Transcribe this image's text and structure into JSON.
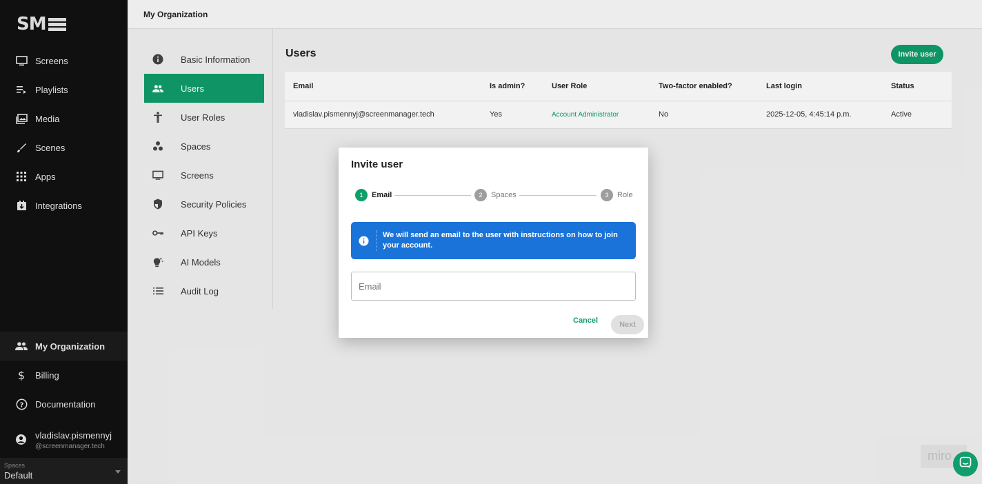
{
  "app": {
    "logo_text": "SM",
    "nav_items": [
      {
        "label": "Screens",
        "icon": "monitor-icon"
      },
      {
        "label": "Playlists",
        "icon": "playlist-icon"
      },
      {
        "label": "Media",
        "icon": "media-icon"
      },
      {
        "label": "Scenes",
        "icon": "brush-icon"
      },
      {
        "label": "Apps",
        "icon": "apps-grid-icon"
      },
      {
        "label": "Integrations",
        "icon": "integrations-icon"
      }
    ],
    "bottom_items": [
      {
        "label": "My Organization",
        "icon": "people-icon",
        "active": true
      },
      {
        "label": "Billing",
        "icon": "dollar-icon"
      },
      {
        "label": "Documentation",
        "icon": "help-icon"
      }
    ],
    "user": {
      "name": "vladislav.pismennyj",
      "domain": "@screenmanager.tech"
    },
    "spaces": {
      "label": "Spaces",
      "value": "Default"
    }
  },
  "topbar": {
    "title": "My Organization"
  },
  "org_menu": [
    {
      "label": "Basic Information",
      "icon": "info-icon"
    },
    {
      "label": "Users",
      "icon": "people-icon",
      "active": true
    },
    {
      "label": "User Roles",
      "icon": "person-icon"
    },
    {
      "label": "Spaces",
      "icon": "spaces-icon"
    },
    {
      "label": "Screens",
      "icon": "monitor-icon"
    },
    {
      "label": "Security Policies",
      "icon": "shield-icon"
    },
    {
      "label": "API Keys",
      "icon": "key-icon"
    },
    {
      "label": "AI Models",
      "icon": "ai-bulb-icon"
    },
    {
      "label": "Audit Log",
      "icon": "list-icon"
    }
  ],
  "users": {
    "title": "Users",
    "invite_label": "Invite user",
    "columns": [
      "Email",
      "Is admin?",
      "User Role",
      "Two-factor enabled?",
      "Last login",
      "Status"
    ],
    "rows": [
      [
        "vladislav.pismennyj@screenmanager.tech",
        "Yes",
        "Account Administrator",
        "No",
        "2025-12-05, 4:45:14 p.m.",
        "Active"
      ]
    ]
  },
  "modal": {
    "title": "Invite user",
    "steps": [
      {
        "num": "1",
        "label": "Email"
      },
      {
        "num": "2",
        "label": "Spaces"
      },
      {
        "num": "3",
        "label": "Role"
      }
    ],
    "info": "We will send an email to the user with instructions on how to join your account.",
    "email_placeholder": "Email",
    "cancel_label": "Cancel",
    "next_label": "Next"
  },
  "watermark": "miro",
  "colors": {
    "accent": "#109e6b",
    "info": "#1a73d9",
    "sidebar": "#111111"
  }
}
